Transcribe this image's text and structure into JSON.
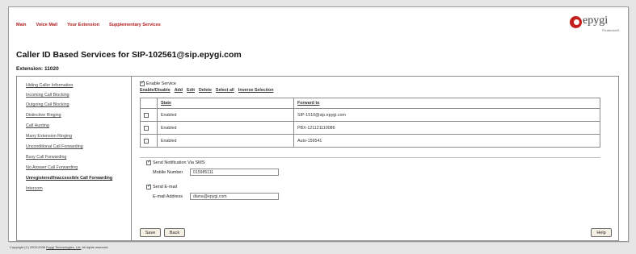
{
  "nav": {
    "main": "Main",
    "voicemail": "Voice Mail",
    "extension": "Your Extension",
    "supplementary": "Supplementary Services"
  },
  "logo": {
    "text": "epygi",
    "sub": "FDuadro4x4S"
  },
  "page": {
    "title": "Caller ID Based Services for SIP-102561@sip.epygi.com",
    "extension_label": "Extension: 11020"
  },
  "sidebar": {
    "items": [
      {
        "label": "Hiding Caller Information"
      },
      {
        "label": "Incoming Call Blocking"
      },
      {
        "label": "Outgoing Call Blocking"
      },
      {
        "label": "Distinctive Ringing"
      },
      {
        "label": "Call Hunting"
      },
      {
        "label": "Many Extension Ringing"
      },
      {
        "label": "Unconditional Call Forwarding"
      },
      {
        "label": "Busy Call Forwarding"
      },
      {
        "label": "No Answer Call Forwarding"
      },
      {
        "label": "Unregistered/Inaccessible Call Forwarding"
      },
      {
        "label": "Intercom"
      }
    ]
  },
  "main": {
    "enable_service_label": "Enable Service",
    "actions": {
      "enable_disable": "Enable/Disable",
      "add": "Add",
      "edit": "Edit",
      "delete": "Delete",
      "select_all": "Select all",
      "inverse": "Inverse Selection"
    },
    "table": {
      "headers": [
        "State",
        "Forward to"
      ],
      "rows": [
        {
          "state": "Enabled",
          "forward": "SIP-1510@sip.epygi.com"
        },
        {
          "state": "Enabled",
          "forward": "PBX-121121110086"
        },
        {
          "state": "Enabled",
          "forward": "Auto-159541"
        }
      ]
    },
    "sms": {
      "checkbox_label": "Send Notification Via SMS",
      "mobile_label": "Mobile Number",
      "mobile_value": "015985111"
    },
    "email": {
      "checkbox_label": "Send E-mail",
      "address_label": "E-mail Address",
      "address_value": "diana@epygi.com"
    }
  },
  "buttons": {
    "save": "Save",
    "back": "Back",
    "help": "Help"
  },
  "footer": {
    "prefix": "Copyright (C) 2003-2006",
    "link": "Epygi Technologies, Ltd.",
    "suffix": "All rights reserved."
  }
}
